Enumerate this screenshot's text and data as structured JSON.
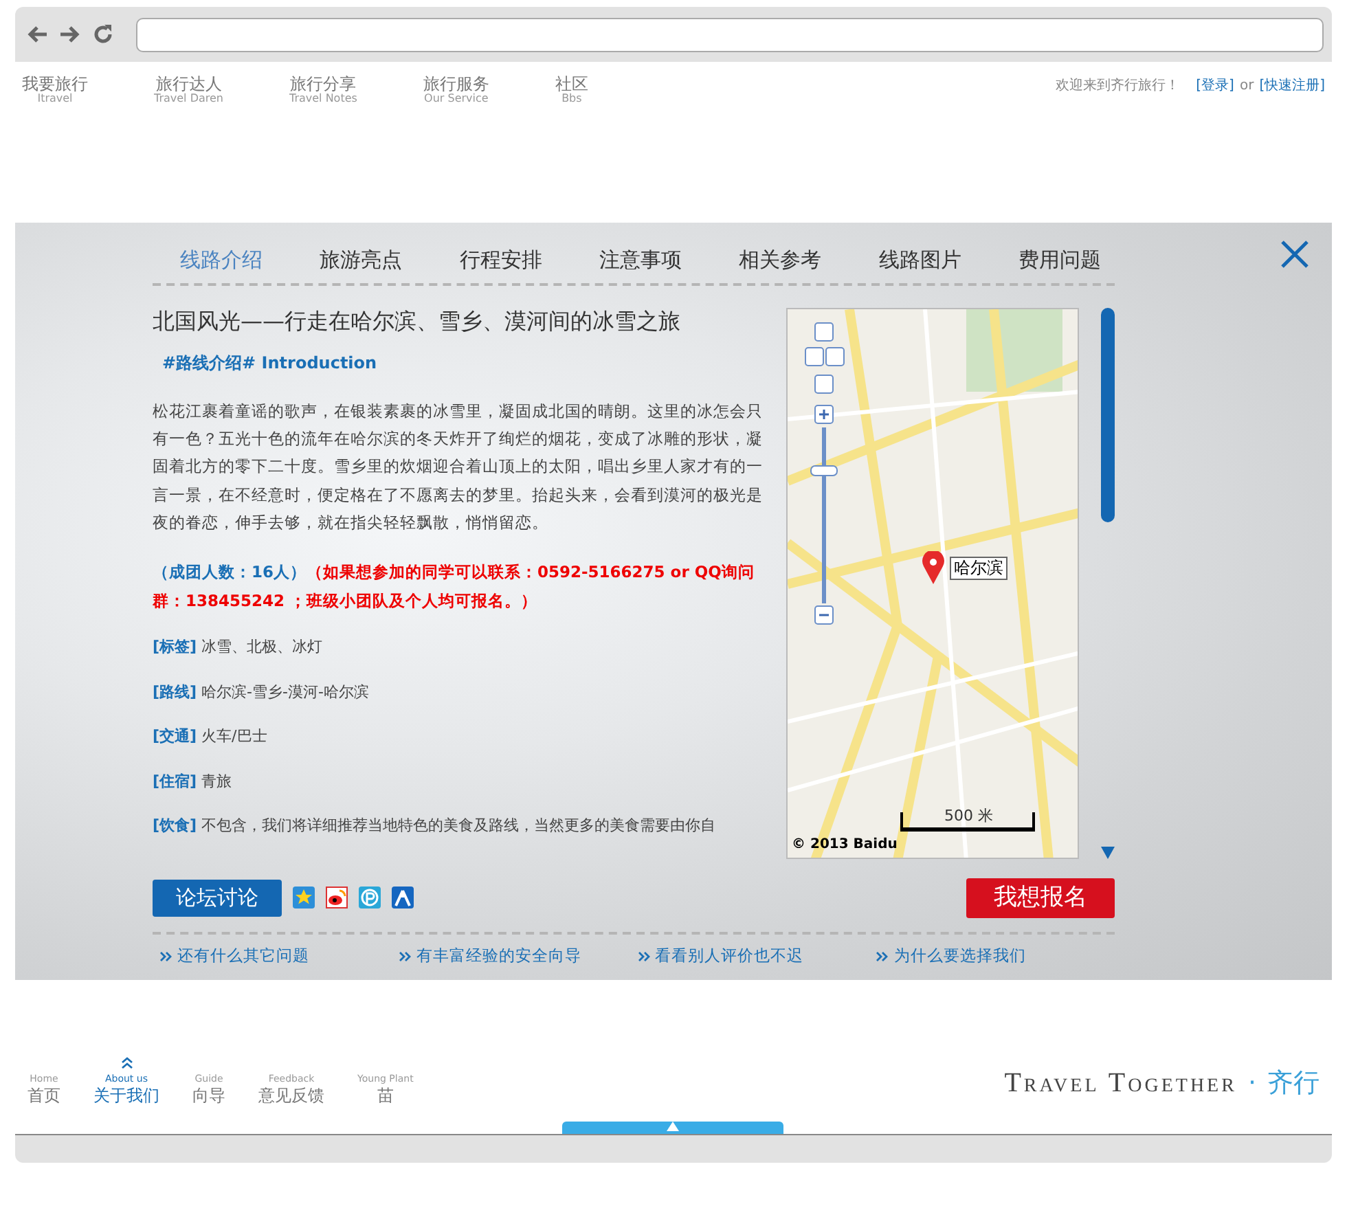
{
  "header": {
    "nav": [
      {
        "zh": "我要旅行",
        "en": "Itravel"
      },
      {
        "zh": "旅行达人",
        "en": "Travel Daren"
      },
      {
        "zh": "旅行分享",
        "en": "Travel Notes"
      },
      {
        "zh": "旅行服务",
        "en": "Our Service"
      },
      {
        "zh": "社区",
        "en": "Bbs"
      }
    ],
    "welcome": "欢迎来到齐行旅行！",
    "login": "[登录]",
    "or": "or",
    "register": "[快速注册]"
  },
  "tabs": [
    {
      "label": "线路介绍",
      "selected": true
    },
    {
      "label": "旅游亮点",
      "selected": false
    },
    {
      "label": "行程安排",
      "selected": false
    },
    {
      "label": "注意事项",
      "selected": false
    },
    {
      "label": "相关参考",
      "selected": false
    },
    {
      "label": "线路图片",
      "selected": false
    },
    {
      "label": "费用问题",
      "selected": false
    }
  ],
  "article": {
    "title": "北国风光——行走在哈尔滨、雪乡、漠河间的冰雪之旅",
    "section_tag": "#路线介绍# Introduction",
    "intro": "松花江裹着童谣的歌声，在银装素裹的冰雪里，凝固成北国的晴朗。这里的冰怎会只有一色？五光十色的流年在哈尔滨的冬天炸开了绚烂的烟花，变成了冰雕的形状，凝固着北方的零下二十度。雪乡里的炊烟迎合着山顶上的太阳，唱出乡里人家才有的一言一景，在不经意时，便定格在了不愿离去的梦里。抬起头来，会看到漠河的极光是夜的眷恋，伸手去够，就在指尖轻轻飘散，悄悄留恋。",
    "group_size": "（成团人数：16人）",
    "contact": "（如果想参加的同学可以联系：0592-5166275 or QQ询问群：138455242 ；班级小团队及个人均可报名。）",
    "facts": [
      {
        "label": "[标签]",
        "value": "冰雪、北极、冰灯"
      },
      {
        "label": "[路线]",
        "value": "哈尔滨-雪乡-漠河-哈尔滨"
      },
      {
        "label": "[交通]",
        "value": "火车/巴士"
      },
      {
        "label": "[住宿]",
        "value": "青旅"
      },
      {
        "label": "[饮食]",
        "value": "不包含，我们将详细推荐当地特色的美食及路线，当然更多的美食需要由你自"
      }
    ]
  },
  "map": {
    "marker_label": "哈尔滨",
    "scale": "500 米",
    "copyright": "© 2013 Baidu"
  },
  "forum_button": "论坛讨论",
  "signup_button": "我想报名",
  "links": [
    "还有什么其它问题",
    "有丰富经验的安全向导",
    "看看别人评价也不迟",
    "为什么要选择我们"
  ],
  "footer": {
    "nav": [
      {
        "en": "Home",
        "zh": "首页",
        "selected": false
      },
      {
        "en": "About us",
        "zh": "关于我们",
        "selected": true
      },
      {
        "en": "Guide",
        "zh": "向导",
        "selected": false
      },
      {
        "en": "Feedback",
        "zh": "意见反馈",
        "selected": false
      },
      {
        "en": "Young Plant",
        "zh": "苗",
        "selected": false
      }
    ],
    "logo_text": "Travel Together",
    "logo_mark": "·",
    "logo_zh": "齐行"
  }
}
